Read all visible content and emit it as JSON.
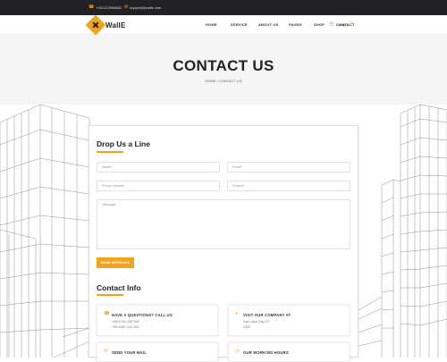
{
  "topbar": {
    "phone": "+001123984881",
    "email": "support@walle.com",
    "phone_icon": "phone-icon",
    "email_icon": "mail-icon"
  },
  "brand": {
    "logo_text": "WallE"
  },
  "nav": {
    "items": [
      "HOME",
      "SERVICE",
      "ABOUT US",
      "PAGES",
      "SHOP",
      "CONTACT"
    ],
    "cart_label": "Cart(0)",
    "cart_icon": "cart-icon",
    "search_icon": "search-icon"
  },
  "hero": {
    "title": "CONTACT US",
    "breadcrumb": "HOME / CONTACT US"
  },
  "form": {
    "heading": "Drop Us a Line",
    "name_placeholder": "Name*",
    "email_placeholder": "Email*",
    "phone_placeholder": "Phone Number",
    "subject_placeholder": "Subject",
    "message_placeholder": "Message...",
    "send_label": "SEND MESSAGE"
  },
  "contact_info": {
    "heading": "Contact Info",
    "boxes": [
      {
        "title": "HAVE A QUESTIONS? CALL US",
        "lines": [
          "+86 6781 208 369",
          "+86 5487 141 361"
        ],
        "icon": "phone-icon"
      },
      {
        "title": "VISIT OUR COMPANY AT",
        "lines": [
          "Salt Lake City UT",
          "USA"
        ],
        "icon": "map-pin-icon"
      },
      {
        "title": "SEND YOUR MAIL",
        "lines": [],
        "icon": "mail-icon"
      },
      {
        "title": "OUR WORKING HOURS",
        "lines": [],
        "icon": "clock-icon"
      }
    ]
  },
  "colors": {
    "accent": "#f2a31a",
    "dark": "#222226",
    "hero_bg": "#f5f5f5"
  }
}
